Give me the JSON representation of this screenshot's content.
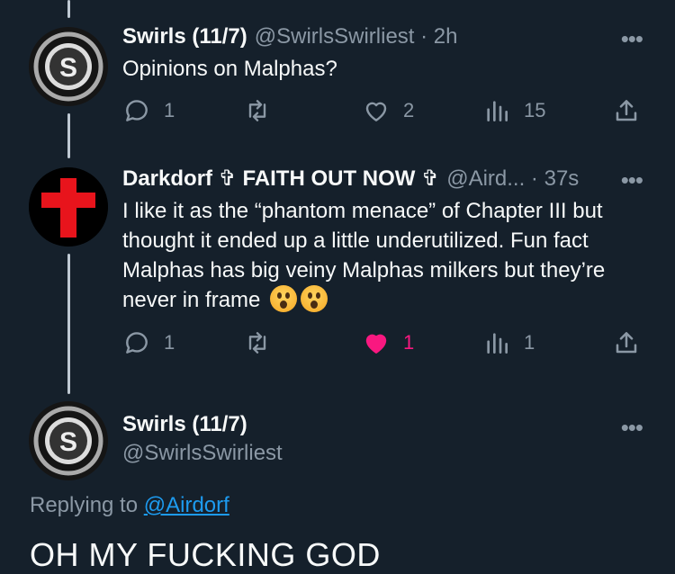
{
  "post1": {
    "name": "Swirls (11/7)",
    "handle_time": "@SwirlsSwirliest · 2h",
    "text": "Opinions on Malphas?",
    "more": "•••",
    "replies": "1",
    "retweets": "",
    "likes": "2",
    "views": "15"
  },
  "post2": {
    "name": "Darkdorf ✞ FAITH OUT NOW ✞",
    "handle_time": "@Aird... · 37s",
    "text": "I like it as the “phantom menace” of Chapter III but thought it ended up a little underutilized. Fun fact Malphas has big veiny Malphas milkers but they’re never in frame",
    "more": "•••",
    "replies": "1",
    "likes": "1",
    "views": "1"
  },
  "main": {
    "name": "Swirls (11/7)",
    "handle": "@SwirlsSwirliest",
    "more": "•••",
    "replying_prefix": "Replying to ",
    "replying_to": "@Airdorf",
    "text": "OH MY FUCKING GOD"
  },
  "icons": {
    "reply": "reply-icon",
    "retweet": "retweet-icon",
    "like": "heart-icon",
    "views": "views-icon",
    "share": "share-icon",
    "emoji": "astonished-face-emoji"
  },
  "colors": {
    "background": "#15202b",
    "muted": "#8b98a5",
    "link": "#1d9bf0",
    "like_active": "#f91880"
  }
}
